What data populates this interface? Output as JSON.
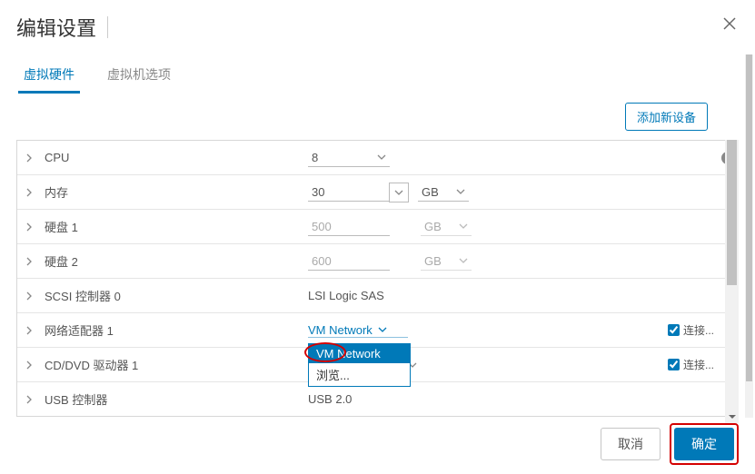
{
  "dialog": {
    "title": "编辑设置",
    "tabs": [
      {
        "label": "虚拟硬件",
        "active": true
      },
      {
        "label": "虚拟机选项",
        "active": false
      }
    ],
    "add_device_label": "添加新设备"
  },
  "rows": {
    "cpu": {
      "label": "CPU",
      "value": "8"
    },
    "memory": {
      "label": "内存",
      "value": "30",
      "unit": "GB"
    },
    "disk1": {
      "label": "硬盘 1",
      "value": "500",
      "unit": "GB"
    },
    "disk2": {
      "label": "硬盘 2",
      "value": "600",
      "unit": "GB"
    },
    "scsi": {
      "label": "SCSI 控制器 0",
      "value": "LSI Logic SAS"
    },
    "net1": {
      "label": "网络适配器 1",
      "value": "VM Network",
      "connected_label": "连接..."
    },
    "cddvd": {
      "label": "CD/DVD 驱动器 1",
      "connected_label": "连接..."
    },
    "usb": {
      "label": "USB 控制器",
      "value": "USB 2.0"
    }
  },
  "network_dropdown": {
    "options": [
      {
        "label": "VM Network",
        "active": true
      },
      {
        "label": "浏览...",
        "active": false
      }
    ]
  },
  "footer": {
    "cancel": "取消",
    "ok": "确定"
  }
}
